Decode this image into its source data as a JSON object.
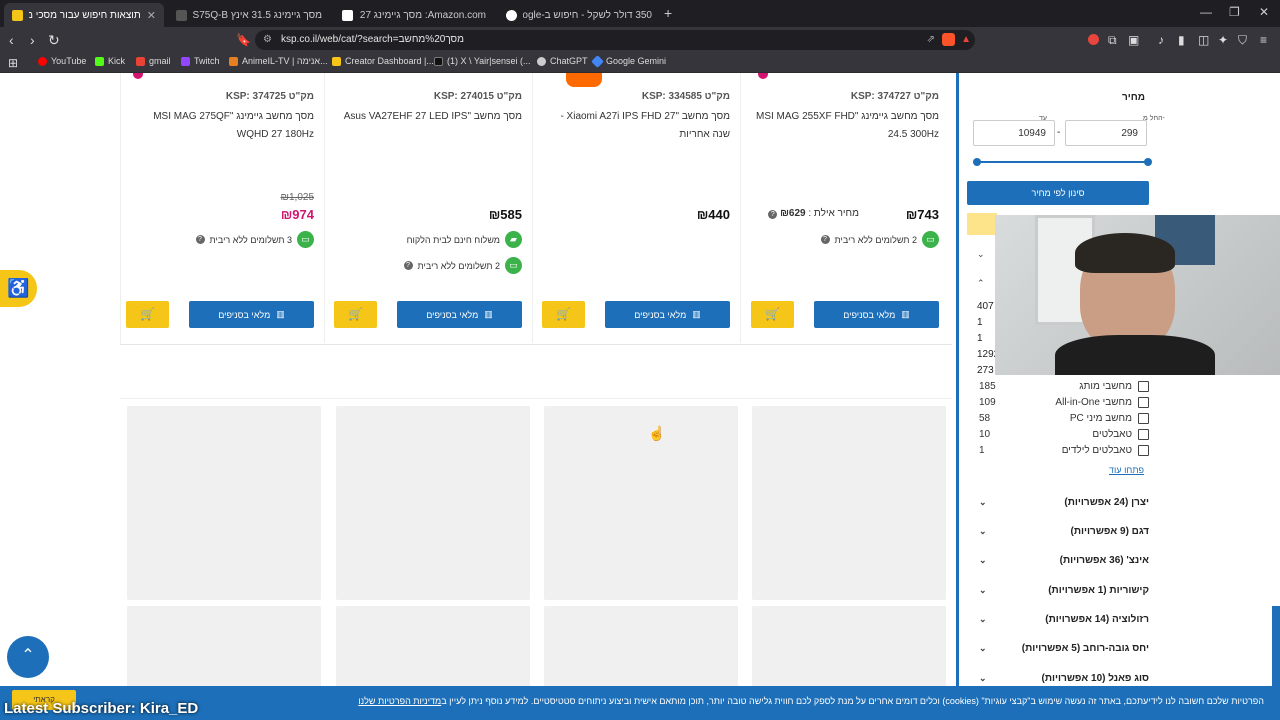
{
  "tabs": [
    {
      "title": "תוצאות חיפוש עבור מסכי מחשב",
      "active": true,
      "favicon_color": "#f5c518"
    },
    {
      "title": "מסך גיימינג 31.5 אינץ LG 32GS75Q-B",
      "active": false,
      "favicon_color": "#555555"
    },
    {
      "title": "Amazon.com: מסך גיימינג LG 27 אינץ' U",
      "active": false,
      "favicon_color": "#ffffff"
    },
    {
      "title": "350 דולר לשקל - חיפוש ב-Google",
      "active": false,
      "favicon_color": "#ffffff"
    }
  ],
  "new_tab_label": "+",
  "window": {
    "minimize": "—",
    "restore": "❐",
    "close": "✕"
  },
  "address": {
    "url": "ksp.co.il/web/cat/?search=מסך%20מחשב"
  },
  "bookmarks": [
    {
      "label": "YouTube",
      "color": "#ff0000"
    },
    {
      "label": "Kick",
      "color": "#53fc18"
    },
    {
      "label": "gmail",
      "color": "#ea4335"
    },
    {
      "label": "Twitch",
      "color": "#9146ff"
    },
    {
      "label": "AnimeIL-TV | אנימה...",
      "color": "#e67e22"
    },
    {
      "label": "Creator Dashboard |...",
      "color": "#f5c518"
    },
    {
      "label": "(1) X \\ Yair|sensei (...",
      "color": "#111111"
    },
    {
      "label": "ChatGPT",
      "color": "#cccccc"
    },
    {
      "label": "Google Gemini",
      "color": "#4285f4"
    }
  ],
  "products": [
    {
      "sku": "מק\"ט KSP: 374725",
      "name": "מסך מחשב גיימינג \"MSI MAG 275QF WQHD 27 180Hz",
      "old_price": "₪1,025",
      "price": "₪974",
      "price_color": "#d3146e",
      "club_label": "",
      "club_price": "",
      "features": [
        "3 תשלומים ללא ריבית"
      ],
      "store_label": "מלאי בסניפים"
    },
    {
      "sku": "מק\"ט KSP: 274015",
      "name": "מסך מחשב \"Asus VA27EHF 27 LED IPS",
      "old_price": "",
      "price": "₪585",
      "price_color": "#111111",
      "club_label": "",
      "club_price": "",
      "features": [
        "משלוח חינם לבית הלקוח",
        "2 תשלומים ללא ריבית"
      ],
      "store_label": "מלאי בסניפים"
    },
    {
      "sku": "מק\"ט KSP: 334585",
      "name": "מסך מחשב \"Xiaomi A27i IPS FHD 27 - שנה אחריות",
      "old_price": "",
      "price": "₪440",
      "price_color": "#111111",
      "club_label": "",
      "club_price": "",
      "features": [],
      "store_label": "מלאי בסניפים"
    },
    {
      "sku": "מק\"ט KSP: 374727",
      "name": "מסך מחשב גיימינג \"MSI MAG 255XF FHD 24.5 300Hz",
      "old_price": "",
      "price": "₪743",
      "price_color": "#111111",
      "club_label": "מחיר אילת :",
      "club_price": "₪629",
      "features": [
        "2 תשלומים ללא ריבית"
      ],
      "store_label": "מלאי בסניפים"
    }
  ],
  "sidebar": {
    "price_title": "מחיר",
    "min_label": "החל מ-",
    "max_label": "עד",
    "min_value": "299",
    "max_value": "10949",
    "range_sep": "-",
    "filter_button": "סינון לפי מחיר",
    "counts_partial": [
      "407",
      "1",
      "1",
      "1292",
      "273"
    ],
    "category_facets": [
      {
        "label": "מחשבי מותג",
        "count": "185"
      },
      {
        "label": "מחשבי All-in-One",
        "count": "109"
      },
      {
        "label": "מחשב מיני PC",
        "count": "58"
      },
      {
        "label": "טאבלטים",
        "count": "10"
      },
      {
        "label": "טאבלטים לילדים",
        "count": "1"
      }
    ],
    "show_more": "פתחו עוד",
    "groups": [
      "יצרן (24 אפשרויות)",
      "דגם (9 אפשרויות)",
      "אינצ' (36 אפשרויות)",
      "קישוריות (1 אפשרויות)",
      "רזולוציה (14 אפשרויות)",
      "יחס גובה-רוחב (5 אפשרויות)",
      "סוג פאנל (10 אפשרויות)"
    ]
  },
  "cookie": {
    "text": "הפרטיות שלכם חשובה לנו לידיעתכם, באתר זה נעשה שימוש ב\"קבצי עוגיות\" (cookies) וכלים דומים אחרים על מנת לספק לכם חווית גלישה טובה יותר, תוכן מותאם אישית וביצוע ניתוחים סטטיסטיים. למידע נוסף ניתן לעיין ב",
    "link": "מדיניות הפרטיות שלנו",
    "accept": "קראתי"
  },
  "overlay_text": "Latest Subscriber: Kira_ED"
}
